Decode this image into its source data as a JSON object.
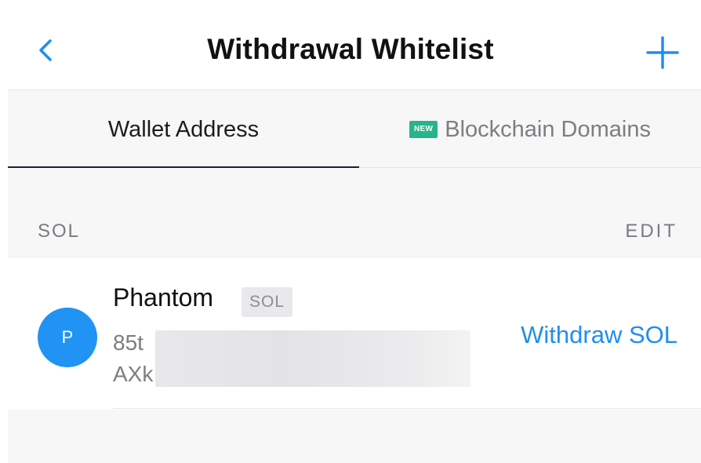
{
  "header": {
    "title": "Withdrawal Whitelist",
    "back_icon": "chevron-left-icon",
    "add_icon": "plus-icon"
  },
  "tabs": [
    {
      "label": "Wallet Address",
      "active": true
    },
    {
      "label": "Blockchain Domains",
      "badge": "NEW",
      "active": false
    }
  ],
  "section": {
    "title": "SOL",
    "edit_label": "EDIT"
  },
  "addresses": [
    {
      "avatar_letter": "P",
      "name": "Phantom",
      "coin_tag": "SOL",
      "address_line_1": "85t",
      "address_line_2": "AXk",
      "action_label": "Withdraw SOL"
    }
  ],
  "colors": {
    "accent": "#1f8ef1",
    "avatar": "#2093f4",
    "badge_green": "#27b48c",
    "tab_underline": "#1b2235"
  }
}
